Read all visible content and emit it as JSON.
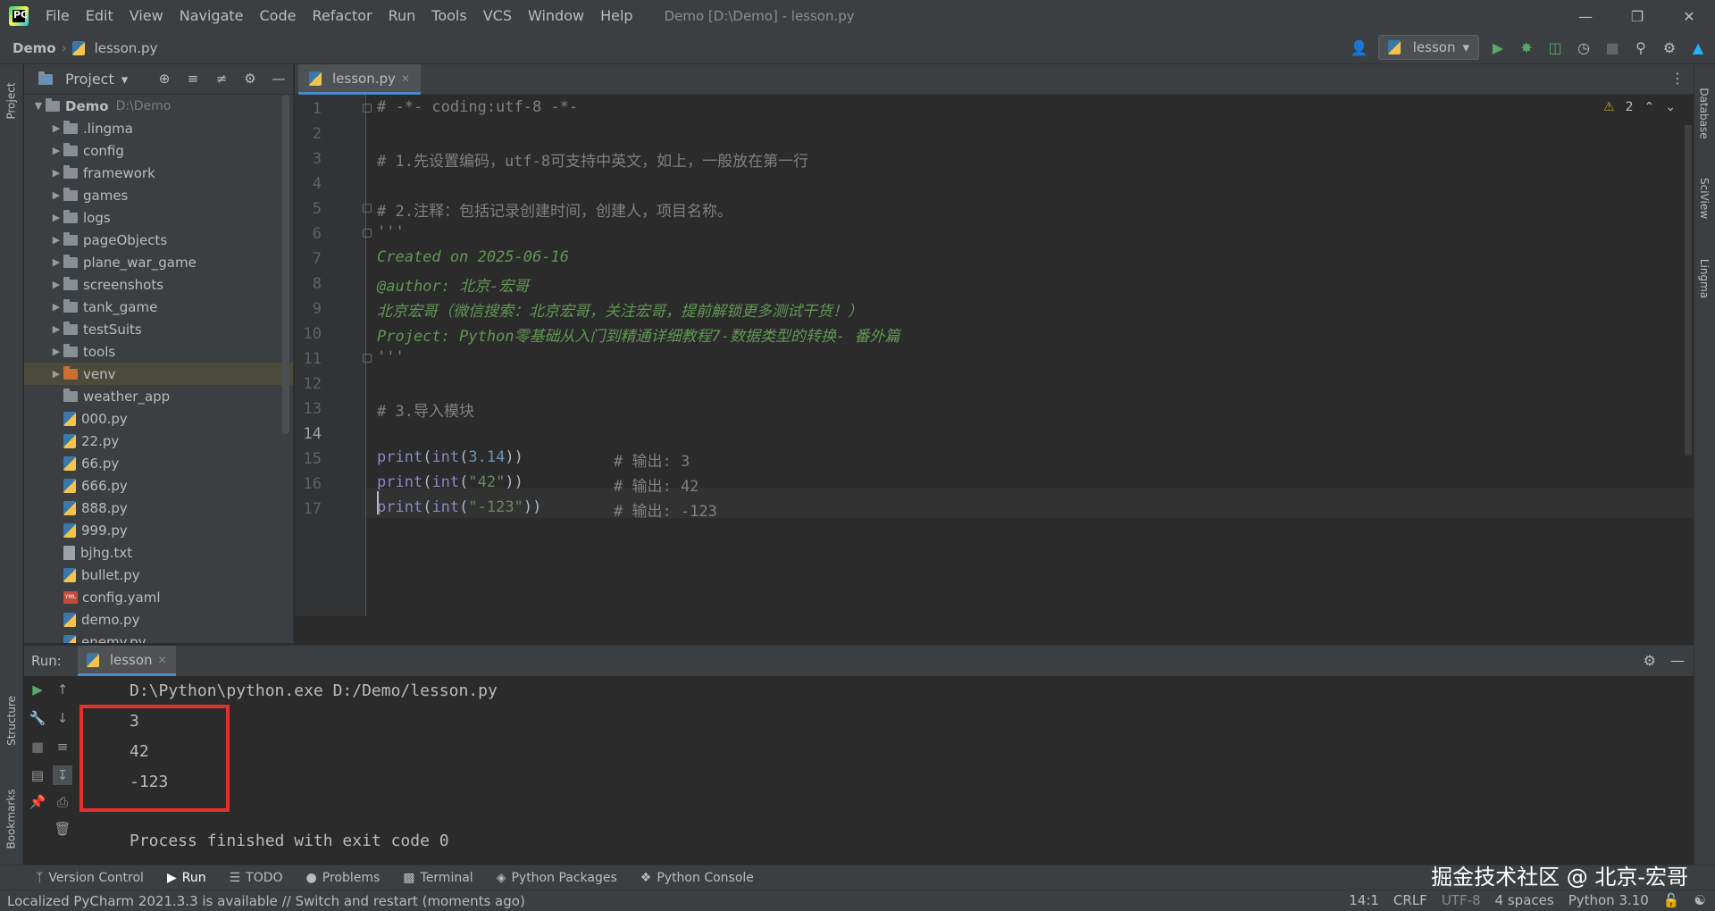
{
  "titlebar": {
    "menu": [
      "File",
      "Edit",
      "View",
      "Navigate",
      "Code",
      "Refactor",
      "Run",
      "Tools",
      "VCS",
      "Window",
      "Help"
    ],
    "window_title": "Demo [D:\\Demo] - lesson.py"
  },
  "navbar": {
    "project": "Demo",
    "file": "lesson.py",
    "run_config": "lesson"
  },
  "left_stripe": {
    "project": "Project",
    "structure": "Structure",
    "bookmarks": "Bookmarks"
  },
  "right_stripe": {
    "database": "Database",
    "sciview": "SciView",
    "lingma": "Lingma"
  },
  "project_panel": {
    "title": "Project",
    "root": {
      "name": "Demo",
      "path": "D:\\Demo"
    },
    "folders": [
      ".lingma",
      "config",
      "framework",
      "games",
      "logs",
      "pageObjects",
      "plane_war_game",
      "screenshots",
      "tank_game",
      "testSuits",
      "tools",
      "venv"
    ],
    "plain_folder": "weather_app",
    "files": [
      "000.py",
      "22.py",
      "66.py",
      "666.py",
      "888.py",
      "999.py",
      "bjhg.txt",
      "bullet.py",
      "config.yaml",
      "demo.py",
      "enemy.py"
    ]
  },
  "editor": {
    "tab": "lesson.py",
    "warnings": "2",
    "line_numbers": [
      "1",
      "2",
      "3",
      "4",
      "5",
      "6",
      "7",
      "8",
      "9",
      "10",
      "11",
      "12",
      "13",
      "14",
      "15",
      "16",
      "17"
    ],
    "lines": {
      "l1": "# -*- coding:utf-8 -*-",
      "l3": "# 1.先设置编码，utf-8可支持中英文，如上，一般放在第一行",
      "l5": "# 2.注释：包括记录创建时间，创建人，项目名称。",
      "l6": "'''",
      "l7": "Created on 2025-06-16",
      "l8": "@author: 北京-宏哥",
      "l9": "北京宏哥（微信搜索：北京宏哥，关注宏哥，提前解锁更多测试干货！）",
      "l10": "Project: Python零基础从入门到精通详细教程7-数据类型的转换- 番外篇",
      "l11": "'''",
      "l13": "# 3.导入模块",
      "l15_print": "print",
      "l15_open": "(",
      "l15_int": "int",
      "l15_arg": "3.14",
      "l15_close": "))",
      "l15_comment": "# 输出: 3",
      "l16_arg": "\"42\"",
      "l16_comment": "# 输出: 42",
      "l17_arg": "\"-123\"",
      "l17_comment": "# 输出: -123"
    }
  },
  "run_panel": {
    "label": "Run:",
    "tab": "lesson",
    "console": [
      "D:\\Python\\python.exe D:/Demo/lesson.py",
      "3",
      "42",
      "-123",
      "",
      "Process finished with exit code 0"
    ]
  },
  "bottom_tools": [
    "Version Control",
    "Run",
    "TODO",
    "Problems",
    "Terminal",
    "Python Packages",
    "Python Console"
  ],
  "watermark": "掘金技术社区 @ 北京-宏哥",
  "statusbar": {
    "message": "Localized PyCharm 2021.3.3 is available // Switch and restart (moments ago)",
    "position": "14:1",
    "line_sep": "CRLF",
    "encoding": "UTF-8",
    "indent": "4 spaces",
    "interpreter": "Python 3.10"
  },
  "colors": {
    "accent": "#4a88c7",
    "highlight_box": "#e5312e",
    "run_green": "#59a869"
  }
}
